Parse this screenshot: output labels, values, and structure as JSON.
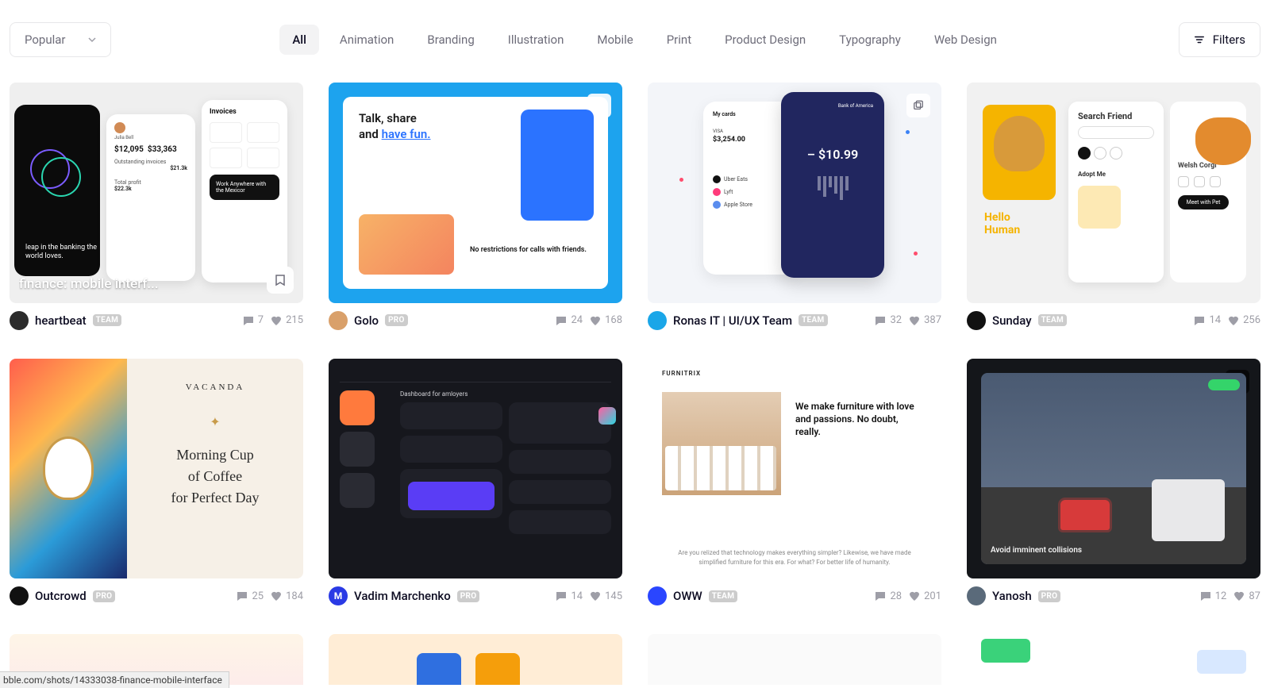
{
  "sort": {
    "label": "Popular"
  },
  "categories": [
    {
      "label": "All",
      "active": true
    },
    {
      "label": "Animation",
      "active": false
    },
    {
      "label": "Branding",
      "active": false
    },
    {
      "label": "Illustration",
      "active": false
    },
    {
      "label": "Mobile",
      "active": false
    },
    {
      "label": "Print",
      "active": false
    },
    {
      "label": "Product Design",
      "active": false
    },
    {
      "label": "Typography",
      "active": false
    },
    {
      "label": "Web Design",
      "active": false
    }
  ],
  "filters": {
    "label": "Filters"
  },
  "shots": [
    {
      "author": "heartbeat",
      "badge": "TEAM",
      "comments": 7,
      "likes": 215,
      "overlay_title": "finance: mobile interf...",
      "avatar_bg": "#2b2b2b",
      "art": {
        "p2_name": "Julia Bell",
        "p2_a": "$12,095",
        "p2_b": "$33,363",
        "p2_c": "$21.3k",
        "p2_d": "$22.3k",
        "p3_title": "Invoices",
        "p3_dark": "Work Anywhere with the Mexicor",
        "leap": "leap in the banking the world loves."
      }
    },
    {
      "author": "Golo",
      "badge": "PRO",
      "comments": 24,
      "likes": 168,
      "avatar_bg": "#d9a06a",
      "art": {
        "headline_a": "Talk, share",
        "headline_b": "and ",
        "headline_c": "have fun.",
        "caption": "No restrictions for calls with friends."
      }
    },
    {
      "author": "Ronas IT | UI/UX Team",
      "badge": "TEAM",
      "comments": 32,
      "likes": 387,
      "avatar_bg": "#1aa6e8",
      "art": {
        "label": "My cards",
        "bank": "Bank of America",
        "amount": "– $10.99",
        "visa": "VISA",
        "bal": "$3,254.00"
      }
    },
    {
      "author": "Sunday",
      "badge": "TEAM",
      "comments": 14,
      "likes": 256,
      "avatar_bg": "#111",
      "art": {
        "search": "Search Friend",
        "adopt": "Adopt Me",
        "hello_a": "Hello",
        "hello_b": "Human",
        "breed": "Welsh Corgi",
        "btn": "Meet with Pet"
      }
    },
    {
      "author": "Outcrowd",
      "badge": "PRO",
      "comments": 25,
      "likes": 184,
      "avatar_bg": "#111",
      "art": {
        "brand": "VACANDA",
        "line1": "Morning Cup",
        "line2": "of Coffee",
        "line3": "for Perfect Day"
      }
    },
    {
      "author": "Vadim Marchenko",
      "badge": "PRO",
      "comments": 14,
      "likes": 145,
      "avatar_bg": "#2a3ae5",
      "art": {
        "title": "Dashboard for amloyers"
      }
    },
    {
      "author": "OWW",
      "badge": "TEAM",
      "comments": 28,
      "likes": 201,
      "avatar_bg": "#2a46ff",
      "art": {
        "brand": "FURNITRIX",
        "headline": "We make furniture with love and passions. No doubt, really.",
        "sub": "Are you relized that technology makes everything simpler? Likewise, we have made simplified furniture for this era. For what? For better life of humanity."
      }
    },
    {
      "author": "Yanosh",
      "badge": "PRO",
      "comments": 12,
      "likes": 87,
      "avatar_bg": "#5a6a7a",
      "art": {
        "caption": "Avoid imminent collisions"
      }
    }
  ],
  "status_url": "bble.com/shots/14333038-finance-mobile-interface"
}
